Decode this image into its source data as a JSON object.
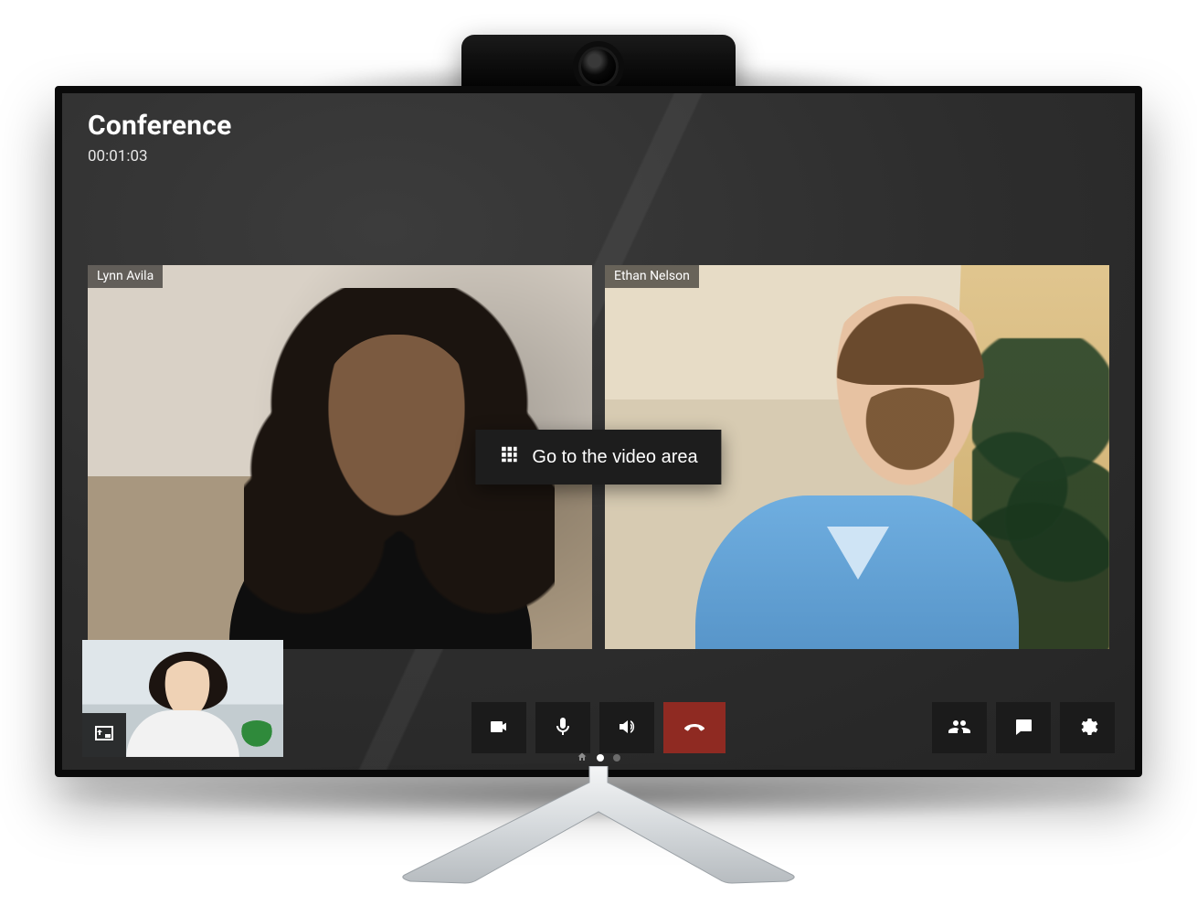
{
  "header": {
    "title": "Conference",
    "elapsed": "00:01:03"
  },
  "participants": [
    {
      "name": "Lynn Avila"
    },
    {
      "name": "Ethan Nelson"
    }
  ],
  "overlay": {
    "label": "Go to the video area"
  },
  "controls": {
    "self_swap_icon": "pip-swap-icon",
    "center": [
      {
        "id": "camera",
        "icon": "camera-icon"
      },
      {
        "id": "mic",
        "icon": "mic-icon"
      },
      {
        "id": "speaker",
        "icon": "speaker-icon"
      },
      {
        "id": "hangup",
        "icon": "hangup-icon",
        "danger": true
      }
    ],
    "right": [
      {
        "id": "participants",
        "icon": "people-icon"
      },
      {
        "id": "chat",
        "icon": "chat-icon"
      },
      {
        "id": "settings",
        "icon": "gear-icon"
      }
    ]
  },
  "pager": {
    "pages": 2,
    "active": 1
  }
}
